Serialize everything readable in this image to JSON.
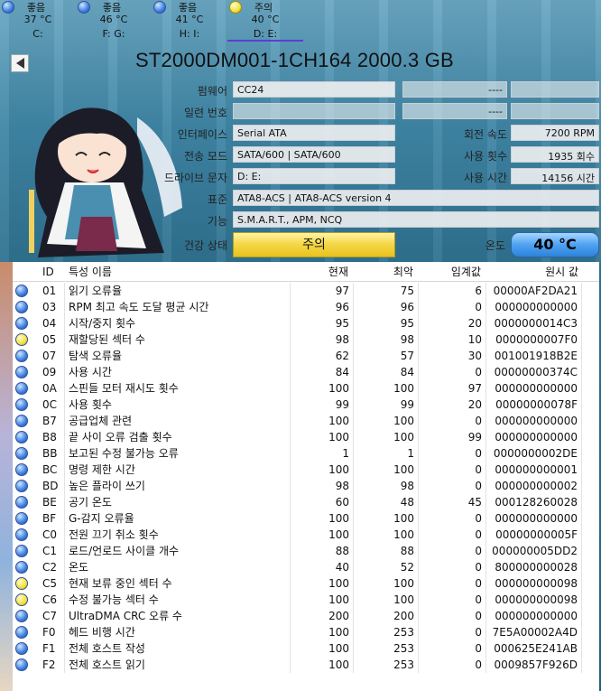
{
  "tabs": [
    {
      "status": "좋음",
      "temp": "37 °C",
      "drive": "C:",
      "dot": "blue"
    },
    {
      "status": "좋음",
      "temp": "46 °C",
      "drive": "F: G:",
      "dot": "blue"
    },
    {
      "status": "좋음",
      "temp": "41 °C",
      "drive": "H: I:",
      "dot": "blue"
    },
    {
      "status": "주의",
      "temp": "40 °C",
      "drive": "D: E:",
      "dot": "yellow"
    }
  ],
  "model_title": "ST2000DM001-1CH164 2000.3 GB",
  "info": {
    "firmware_label": "펌웨어",
    "firmware": "CC24",
    "serial_label": "일련 번호",
    "serial": "",
    "interface_label": "인터페이스",
    "interface": "Serial ATA",
    "transfer_label": "전송 모드",
    "transfer": "SATA/600 | SATA/600",
    "drive_letter_label": "드라이브 문자",
    "drive_letter": "D: E:",
    "standard_label": "표준",
    "standard": "ATA8-ACS | ATA8-ACS version 4",
    "features_label": "기능",
    "features": "S.M.A.R.T., APM, NCQ",
    "right_blank1": "----",
    "right_blank2": "----",
    "rotation_label": "회전 속도",
    "rotation": "7200 RPM",
    "power_count_label": "사용 횟수",
    "power_count": "1935 회수",
    "power_hours_label": "사용 시간",
    "power_hours": "14156 시간",
    "health_label": "건강 상태",
    "health": "주의",
    "temp_label": "온도",
    "temp": "40 °C"
  },
  "table": {
    "headers": {
      "id": "ID",
      "name": "특성 이름",
      "current": "현재",
      "worst": "최악",
      "threshold": "임계값",
      "raw": "원시 값"
    },
    "rows": [
      {
        "dot": "blue",
        "id": "01",
        "name": "읽기 오류율",
        "current": "97",
        "worst": "75",
        "threshold": "6",
        "raw": "00000AF2DA21"
      },
      {
        "dot": "blue",
        "id": "03",
        "name": "RPM 최고 속도 도달 평균 시간",
        "current": "96",
        "worst": "96",
        "threshold": "0",
        "raw": "000000000000"
      },
      {
        "dot": "blue",
        "id": "04",
        "name": "시작/중지 횟수",
        "current": "95",
        "worst": "95",
        "threshold": "20",
        "raw": "0000000014C3"
      },
      {
        "dot": "yellow",
        "id": "05",
        "name": "재할당된 섹터 수",
        "current": "98",
        "worst": "98",
        "threshold": "10",
        "raw": "0000000007F0"
      },
      {
        "dot": "blue",
        "id": "07",
        "name": "탐색 오류율",
        "current": "62",
        "worst": "57",
        "threshold": "30",
        "raw": "001001918B2E"
      },
      {
        "dot": "blue",
        "id": "09",
        "name": "사용 시간",
        "current": "84",
        "worst": "84",
        "threshold": "0",
        "raw": "00000000374C"
      },
      {
        "dot": "blue",
        "id": "0A",
        "name": "스핀들 모터 재시도 횟수",
        "current": "100",
        "worst": "100",
        "threshold": "97",
        "raw": "000000000000"
      },
      {
        "dot": "blue",
        "id": "0C",
        "name": "사용 횟수",
        "current": "99",
        "worst": "99",
        "threshold": "20",
        "raw": "00000000078F"
      },
      {
        "dot": "blue",
        "id": "B7",
        "name": "공급업체 관련",
        "current": "100",
        "worst": "100",
        "threshold": "0",
        "raw": "000000000000"
      },
      {
        "dot": "blue",
        "id": "B8",
        "name": "끝 사이 오류 검출 횟수",
        "current": "100",
        "worst": "100",
        "threshold": "99",
        "raw": "000000000000"
      },
      {
        "dot": "blue",
        "id": "BB",
        "name": "보고된 수정 불가능 오류",
        "current": "1",
        "worst": "1",
        "threshold": "0",
        "raw": "0000000002DE"
      },
      {
        "dot": "blue",
        "id": "BC",
        "name": "명령 제한 시간",
        "current": "100",
        "worst": "100",
        "threshold": "0",
        "raw": "000000000001"
      },
      {
        "dot": "blue",
        "id": "BD",
        "name": "높은 플라이 쓰기",
        "current": "98",
        "worst": "98",
        "threshold": "0",
        "raw": "000000000002"
      },
      {
        "dot": "blue",
        "id": "BE",
        "name": "공기 온도",
        "current": "60",
        "worst": "48",
        "threshold": "45",
        "raw": "000128260028"
      },
      {
        "dot": "blue",
        "id": "BF",
        "name": "G-감지 오류율",
        "current": "100",
        "worst": "100",
        "threshold": "0",
        "raw": "000000000000"
      },
      {
        "dot": "blue",
        "id": "C0",
        "name": "전원 끄기 취소 횟수",
        "current": "100",
        "worst": "100",
        "threshold": "0",
        "raw": "00000000005F"
      },
      {
        "dot": "blue",
        "id": "C1",
        "name": "로드/언로드 사이클 개수",
        "current": "88",
        "worst": "88",
        "threshold": "0",
        "raw": "000000005DD2"
      },
      {
        "dot": "blue",
        "id": "C2",
        "name": "온도",
        "current": "40",
        "worst": "52",
        "threshold": "0",
        "raw": "800000000028"
      },
      {
        "dot": "yellow",
        "id": "C5",
        "name": "현재 보류 중인 섹터 수",
        "current": "100",
        "worst": "100",
        "threshold": "0",
        "raw": "000000000098"
      },
      {
        "dot": "yellow",
        "id": "C6",
        "name": "수정 불가능 섹터 수",
        "current": "100",
        "worst": "100",
        "threshold": "0",
        "raw": "000000000098"
      },
      {
        "dot": "blue",
        "id": "C7",
        "name": "UltraDMA CRC 오류 수",
        "current": "200",
        "worst": "200",
        "threshold": "0",
        "raw": "000000000000"
      },
      {
        "dot": "blue",
        "id": "F0",
        "name": "헤드 비행 시간",
        "current": "100",
        "worst": "253",
        "threshold": "0",
        "raw": "7E5A00002A4D"
      },
      {
        "dot": "blue",
        "id": "F1",
        "name": "전체 호스트 작성",
        "current": "100",
        "worst": "253",
        "threshold": "0",
        "raw": "000625E241AB"
      },
      {
        "dot": "blue",
        "id": "F2",
        "name": "전체 호스트 읽기",
        "current": "100",
        "worst": "253",
        "threshold": "0",
        "raw": "0009857F926D"
      }
    ]
  }
}
